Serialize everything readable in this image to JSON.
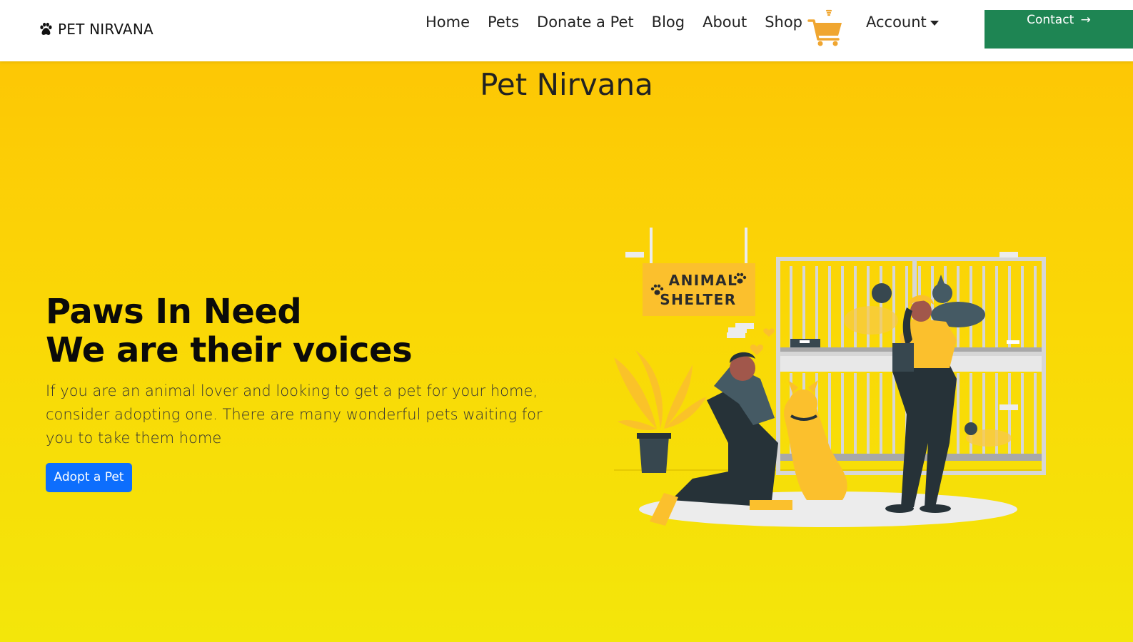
{
  "navbar": {
    "brand": "PET NIRVANA",
    "brand_icon": "paw-icon",
    "links": [
      "Home",
      "Pets",
      "Donate a Pet",
      "Blog",
      "About",
      "Shop"
    ],
    "cart_icon": "shopping-cart-icon",
    "account_label": "Account",
    "contact_label": "Contact",
    "contact_arrow": "→",
    "contact_color": "#1e8553"
  },
  "hero": {
    "title": "Pet Nirvana",
    "headline_line1": "Paws In Need",
    "headline_line2": "We are their voices",
    "description": "If you are an animal lover and looking to get a pet for your home, consider adopting one. There are many wonderful pets waiting for you to take them home",
    "cta_label": "Adopt a Pet",
    "cta_color": "#0d6efd",
    "illustration": {
      "sign_line1": "ANIMAL",
      "sign_line2": "SHELTER"
    }
  }
}
